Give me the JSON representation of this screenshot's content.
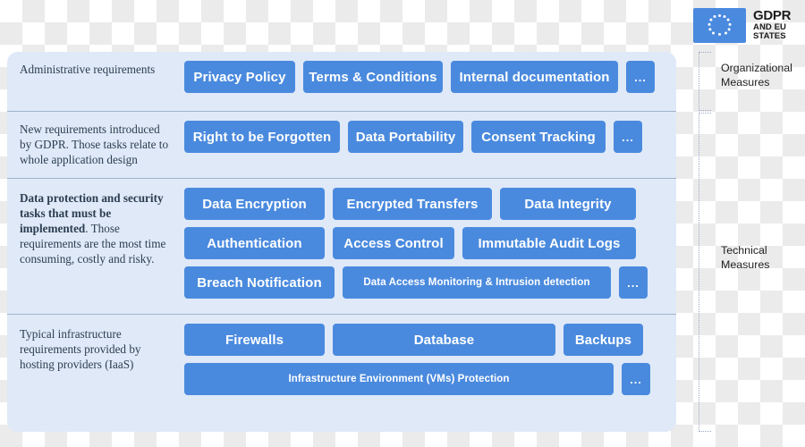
{
  "logo": {
    "flag_name": "eu-flag",
    "flag_color": "#4a8ade",
    "line1": "GDPR",
    "line2": "AND EU",
    "line3": "STATES"
  },
  "brackets": {
    "organizational": "Organizational Measures",
    "organizational_line1": "Organizational",
    "organizational_line2": "Measures",
    "technical": "Technical Measures",
    "technical_line1": "Technical",
    "technical_line2": "Measures"
  },
  "colors": {
    "panel_background": "#dfe9f8",
    "button": "#4a8ade",
    "button_text": "#ffffff",
    "divider": "#9fb3cc",
    "label_text": "#2c3e50"
  },
  "sections": [
    {
      "id": "administrative",
      "label_plain": "Administrative requirements",
      "label_bold": "",
      "label_rest": "",
      "rows": [
        [
          "Privacy Policy",
          "Terms & Conditions",
          "Internal documentation",
          "..."
        ]
      ]
    },
    {
      "id": "new-gdpr",
      "label_plain": "New requirements introduced by GDPR. Those tasks relate to whole application design",
      "label_bold": "",
      "label_rest": "",
      "rows": [
        [
          "Right to be Forgotten",
          "Data Portability",
          "Consent Tracking",
          "..."
        ]
      ]
    },
    {
      "id": "data-protection",
      "label_plain": "",
      "label_bold": "Data protection and security tasks that must be implemented",
      "label_rest": ". Those requirements are the most time consuming, costly and risky.",
      "rows": [
        [
          "Data Encryption",
          "Encrypted Transfers",
          "Data Integrity"
        ],
        [
          "Authentication",
          "Access Control",
          "Immutable Audit Logs"
        ],
        [
          "Breach Notification",
          "Data Access Monitoring & Intrusion detection",
          "..."
        ]
      ]
    },
    {
      "id": "infrastructure",
      "label_plain": "Typical infrastructure requirements provided by hosting providers (IaaS)",
      "label_bold": "",
      "label_rest": "",
      "rows": [
        [
          "Firewalls",
          "Database",
          "Backups"
        ],
        [
          "Infrastructure Environment (VMs) Protection",
          "..."
        ]
      ]
    }
  ]
}
